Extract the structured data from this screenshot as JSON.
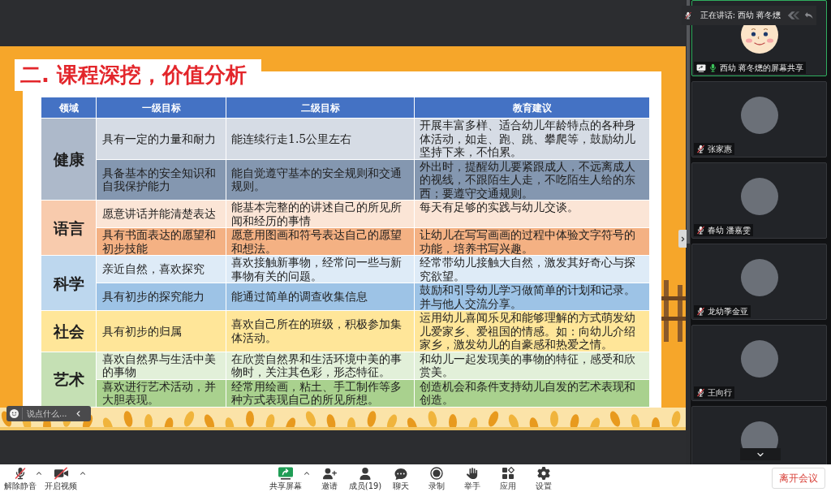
{
  "speaker_banner": {
    "label": "正在讲话: 西幼 蒋冬熜"
  },
  "slide": {
    "title": "二. 课程深挖，价值分析",
    "table": {
      "columns": [
        "领域",
        "一级目标",
        "二级目标",
        "教育建议"
      ],
      "groups": [
        {
          "domain": "健康",
          "color": "#adb9ca",
          "rows": [
            {
              "goal_1": "具有一定的力量和耐力",
              "goal_2": "能连续行走1.5公里左右",
              "advice": "开展丰富多样、适合幼儿年龄特点的各种身体活动，如走、跑、跳、攀爬等，鼓励幼儿坚持下来，不怕累。",
              "color": "#d6dce5"
            },
            {
              "goal_1": "具备基本的安全知识和自我保护能力",
              "goal_2": "能自觉遵守基本的安全规则和交通规则。",
              "advice": "外出时，提醒幼儿要紧跟成人，不远离成人的视线，不跟陌生人走，不吃陌生人给的东西；要遵守交通规则。",
              "color": "#8497b0"
            }
          ]
        },
        {
          "domain": "语言",
          "color": "#f8cbad",
          "rows": [
            {
              "goal_1": "愿意讲话并能清楚表达",
              "goal_2": "能基本完整的的讲述自己的所见所闻和经历的事情",
              "advice": "每天有足够的实践与幼儿交谈。",
              "color": "#fbe5d6"
            },
            {
              "goal_1": "具有书面表达的愿望和初步技能",
              "goal_2": "愿意用图画和符号表达自己的愿望和想法。",
              "advice": "让幼儿在写写画画的过程中体验文字符号的功能，培养书写兴趣。",
              "color": "#f4b183"
            }
          ]
        },
        {
          "domain": "科学",
          "color": "#bdd7ee",
          "rows": [
            {
              "goal_1": "亲近自然，喜欢探究",
              "goal_2": "喜欢接触新事物，经常问一些与新事物有关的问题。",
              "advice": "经常带幼儿接触大自然，激发其好奇心与探究欲望。",
              "color": "#deebf7"
            },
            {
              "goal_1": "具有初步的探究能力",
              "goal_2": "能通过简单的调查收集信息",
              "advice": "鼓励和引导幼儿学习做简单的计划和记录。并与他人交流分享。",
              "color": "#9dc3e6"
            }
          ]
        },
        {
          "domain": "社会",
          "color": "#ffe699",
          "rows": [
            {
              "goal_1": "具有初步的归属",
              "goal_2": "喜欢自己所在的班级，积极参加集体活动。",
              "advice": "运用幼儿喜闻乐见和能够理解的方式萌发幼儿爱家乡、爱祖国的情感。如：向幼儿介绍家乡，激发幼儿的自豪感和热爱之情。",
              "color": "#ffe699"
            }
          ]
        },
        {
          "domain": "艺术",
          "color": "#c5e0b4",
          "rows": [
            {
              "goal_1": "喜欢自然界与生活中美的事物",
              "goal_2": "在欣赏自然界和生活环境中美的事物时，关注其色彩，形态特征。",
              "advice": "和幼儿一起发现美的事物的特征，感受和欣赏美。",
              "color": "#e2f0d9"
            },
            {
              "goal_1": "喜欢进行艺术活动，并大胆表现。",
              "goal_2": "经常用绘画，粘土、手工制作等多种方式表现自己的所见所想。",
              "advice": "创造机会和条件支持幼儿自发的艺术表现和创造。",
              "color": "#a9d18e"
            }
          ]
        }
      ]
    }
  },
  "chat_input": {
    "placeholder": "说点什么..."
  },
  "participants": [
    {
      "name": "西幼 蒋冬熜的屏幕共享",
      "kind": "cartoon",
      "sharing": true,
      "muted": false,
      "active": true
    },
    {
      "name": "张家惠",
      "kind": "photo",
      "sharing": false,
      "muted": true,
      "active": false
    },
    {
      "name": "春幼 潘嘉雯",
      "kind": "photo",
      "sharing": false,
      "muted": true,
      "active": false
    },
    {
      "name": "龙幼季金亚",
      "kind": "photo",
      "sharing": false,
      "muted": true,
      "active": false
    },
    {
      "name": "王向行",
      "kind": "photo",
      "sharing": false,
      "muted": true,
      "active": false
    },
    {
      "kind": "photo",
      "active": false
    }
  ],
  "toolbar": {
    "left": [
      {
        "kind": "mic",
        "label": "解除静音",
        "on": false,
        "menu": true
      },
      {
        "kind": "camera",
        "label": "开启视频",
        "on": false,
        "menu": true
      }
    ],
    "center": [
      {
        "kind": "share",
        "label": "共享屏幕",
        "menu": true
      },
      {
        "kind": "invite",
        "label": "邀请"
      },
      {
        "kind": "members",
        "label": "成员(19)"
      },
      {
        "kind": "chat",
        "label": "聊天"
      },
      {
        "kind": "record",
        "label": "录制"
      },
      {
        "kind": "raise_hand",
        "label": "举手"
      },
      {
        "kind": "apps",
        "label": "应用"
      },
      {
        "kind": "settings",
        "label": "设置"
      }
    ],
    "leave_button": "离开会议"
  }
}
